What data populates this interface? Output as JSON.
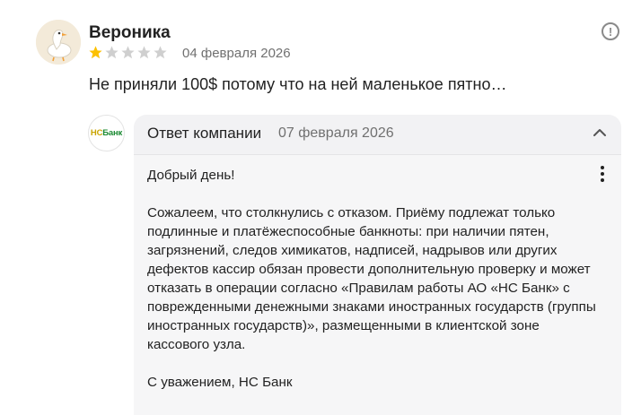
{
  "review": {
    "author_name": "Вероника",
    "avatar_icon": "goose-avatar-icon",
    "rating": 1,
    "rating_max": 5,
    "date": "04 февраля 2026",
    "text": "Не приняли 100$ потому что на ней маленькое пятно…",
    "menu_icon": "exclamation-circle-icon"
  },
  "reply": {
    "logo_ns": "НС",
    "logo_bank": "Банк",
    "title": "Ответ компании",
    "date": "07 февраля 2026",
    "text": "Добрый день!\n\nСожалеем, что столкнулись с отказом. Приёму подлежат только подлинные и платёжеспособные банкноты: при наличии пятен, загрязнений, следов химикатов, надписей, надрывов или других дефектов кассир обязан провести дополнительную проверку и может отказать в операции согласно «Правилам работы АО «НС Банк» с поврежденными денежными знаками иностранных государств (группы иностранных государств)», размещенными в клиентской зоне кассового узла.\n\nС уважением, НС Банк"
  },
  "colors": {
    "star_filled": "#fcc000",
    "star_empty": "#cfcfcf",
    "card_bg": "#f2f2f4",
    "muted_text": "#707070"
  }
}
